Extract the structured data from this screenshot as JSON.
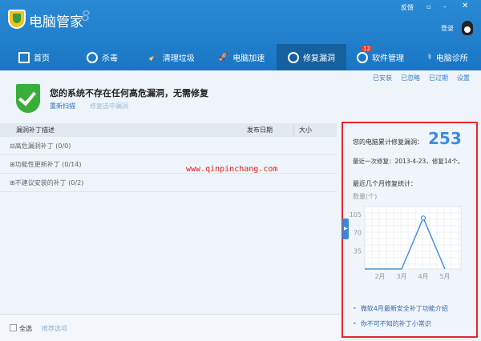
{
  "app": {
    "title": "电脑管家",
    "version_mark": "8",
    "feedback": "反馈",
    "login": "登录"
  },
  "nav": {
    "tabs": [
      {
        "label": "首页",
        "icon": "monitor-icon"
      },
      {
        "label": "杀毒",
        "icon": "lightning-shield-icon"
      },
      {
        "label": "清理垃圾",
        "icon": "broom-icon"
      },
      {
        "label": "电脑加速",
        "icon": "rocket-icon"
      },
      {
        "label": "修复漏洞",
        "icon": "repair-icon",
        "selected": true
      },
      {
        "label": "软件管理",
        "icon": "software-icon",
        "badge": "12"
      },
      {
        "label": "电脑诊所",
        "icon": "stethoscope-icon"
      }
    ]
  },
  "links": [
    "已安装",
    "已忽略",
    "已过期",
    "设置"
  ],
  "status": {
    "message": "您的系统不存在任何高危漏洞，无需修复",
    "rescan": "重新扫描",
    "fix_selected": "修复选中漏洞"
  },
  "table": {
    "headers": [
      "漏洞补丁描述",
      "发布日期",
      "大小"
    ],
    "groups": [
      "⊟高危漏洞补丁 (0/0)",
      "⊞功能性更新补丁 (0/14)",
      "⊞不建议安装的补丁 (0/2)"
    ]
  },
  "watermark": "www.qinpinchang.com",
  "panel": {
    "total_label": "您的电脑累计修复漏洞：",
    "total": "253",
    "last_fix": "最近一次修复：2013-4-23，修复14个。",
    "stats_label": "最近几个月修复统计：",
    "tips": [
      "微软4月最新安全补丁功能介绍",
      "你不可不知的补丁小常识"
    ]
  },
  "chart_data": {
    "type": "line",
    "ylabel": "数量(个)",
    "yticks": [
      35,
      70,
      105
    ],
    "ylim": [
      0,
      120
    ],
    "categories": [
      "2月",
      "3月",
      "4月",
      "5月"
    ],
    "values": [
      0,
      0,
      98,
      0
    ],
    "color": "#4a90d9",
    "grid": true
  },
  "footer": {
    "select_all": "全选",
    "recommended": "推荐选项"
  }
}
